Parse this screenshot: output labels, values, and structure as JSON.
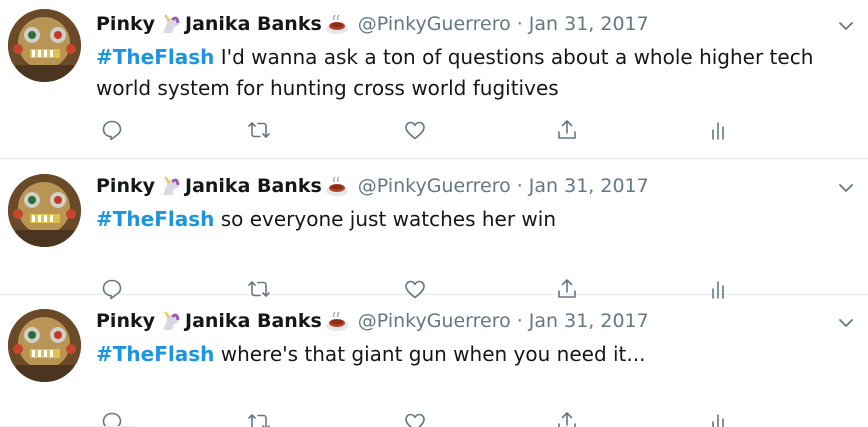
{
  "tweets": [
    {
      "display_name_first": "Pinky",
      "display_name_second": "Janika Banks",
      "handle": "@PinkyGuerrero",
      "separator": "·",
      "date": "Jan 31, 2017",
      "hashtag": "#TheFlash",
      "text": " I'd wanna ask a ton of questions about a whole higher tech world system for hunting cross world fugitives"
    },
    {
      "display_name_first": "Pinky",
      "display_name_second": "Janika Banks",
      "handle": "@PinkyGuerrero",
      "separator": "·",
      "date": "Jan 31, 2017",
      "hashtag": "#TheFlash",
      "text": " so everyone just watches her win"
    },
    {
      "display_name_first": "Pinky",
      "display_name_second": "Janika Banks",
      "handle": "@PinkyGuerrero",
      "separator": "·",
      "date": "Jan 31, 2017",
      "hashtag": "#TheFlash",
      "text": " where's that giant gun when you need it..."
    }
  ],
  "icons": {
    "name_emoji_1": "unicorn-icon",
    "name_emoji_2": "hot-beverage-icon",
    "menu": "chevron-down-icon",
    "reply": "reply-icon",
    "retweet": "retweet-icon",
    "like": "heart-icon",
    "share": "share-icon",
    "analytics": "analytics-icon"
  },
  "colors": {
    "hashtag": "#1b95e0",
    "secondary_text": "#657786",
    "primary_text": "#14171a",
    "divider": "#e6ecf0"
  }
}
